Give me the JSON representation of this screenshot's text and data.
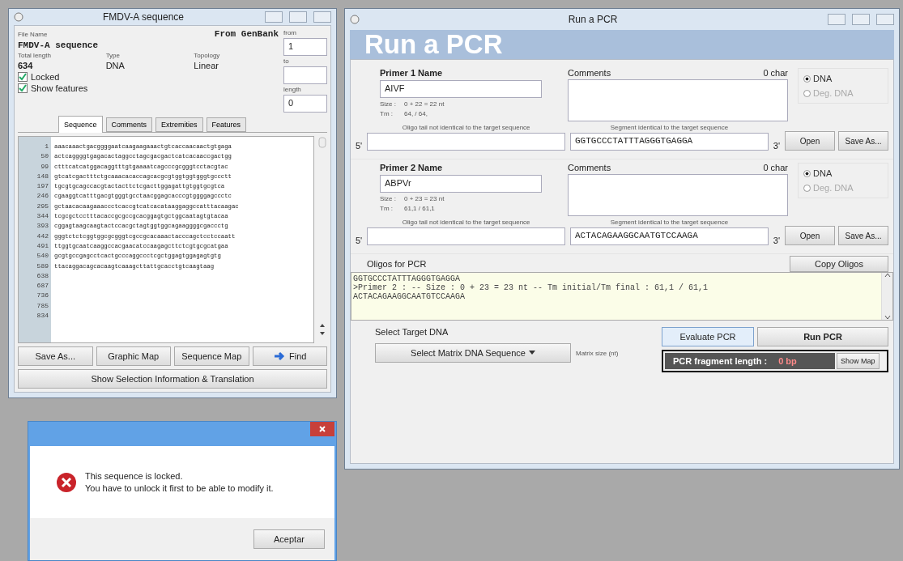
{
  "sequence_window": {
    "title": "FMDV-A sequence",
    "source": "From GenBank",
    "file_name_label": "File Name",
    "file_name": "FMDV-A sequence",
    "total_length_label": "Total length",
    "total_length": "634",
    "type_label": "Type",
    "type": "DNA",
    "topology_label": "Topology",
    "topology": "Linear",
    "from_label": "from",
    "from": "1",
    "to_label": "to",
    "length_label": "length",
    "length": "0",
    "options": [
      {
        "label": "Locked",
        "checked": true
      },
      {
        "label": "Show features",
        "checked": true
      }
    ],
    "tabs": [
      {
        "label": "Sequence",
        "selected": true
      },
      {
        "label": "Comments",
        "selected": false
      },
      {
        "label": "Extremities",
        "selected": false
      },
      {
        "label": "Features",
        "selected": false
      }
    ],
    "sequence_lines": [
      {
        "number": "1",
        "bases": "aaacaaactgacggggaatcaagaagaaactgtcaccaacaactgtgaga"
      },
      {
        "number": "50",
        "bases": "actcaggggtgagacactaggcctagcgacgactcatcacaaccgactgg"
      },
      {
        "number": "99",
        "bases": "ctttcatcatggacaggtttgtgaaaatcagcccgcgggtcctacgtac"
      },
      {
        "number": "148",
        "bases": "gtcatcgactttctgcaaacacaccagcacgcgtggtggtgggtgccctt"
      },
      {
        "number": "197",
        "bases": "tgcgtgcagccacgtactacttctcgacttggagattgtggtgcgtca"
      },
      {
        "number": "246",
        "bases": "cgaaggtcatttgacgtgggtgcctaacggagcacccgtggggagccctc"
      },
      {
        "number": "295",
        "bases": "gctaacacaagaaaccctcaccgtcatcacataaggaggccatttacaagac"
      },
      {
        "number": "344",
        "bases": "tcgcgctcctttacaccgcgccgcacggagtgctggcaatagtgtacaa"
      },
      {
        "number": "393",
        "bases": "cggagtaagcaagtactccacgctagtggtggcagaaggggcgaccctg"
      },
      {
        "number": "442",
        "bases": "gggtctctcggtggcgcgggtcgccgcacaaactacccagctcctccaatt"
      },
      {
        "number": "491",
        "bases": "ttggtgcaatcaaggccacgaacatccaagagcttctcgtgcgcatgaa"
      },
      {
        "number": "540",
        "bases": "gcgtgccgagcctcactgcccaggccctcgctggagtggagagtgtg"
      },
      {
        "number": "589",
        "bases": "ttacaggacagcacaagtcaaagcttattgcacctgtcaagtaag"
      }
    ],
    "empty_line_numbers": [
      "638",
      "687",
      "736",
      "785",
      "834"
    ],
    "buttons": [
      "Save As...",
      "Graphic Map",
      "Sequence Map"
    ],
    "find_button": "Find",
    "wide_button": "Show Selection Information & Translation"
  },
  "alert_dialog": {
    "messages": [
      "This sequence is locked.",
      "You have to unlock it first to be able to modify it."
    ],
    "button": "Aceptar"
  },
  "pcr_window": {
    "title": "Run a PCR",
    "banner": "Run a PCR",
    "primers": [
      {
        "name_label": "Primer 1 Name",
        "name": "AIVF",
        "comments_label": "Comments",
        "char_count": "0 char",
        "size_label": "Size :",
        "size": "0 + 22 = 22 nt",
        "tm_label": "Tm :",
        "tm": "64, / 64,",
        "tail_label": "Oligo tail not identical to the target sequence",
        "segment_label": "Segment identical to the target sequence",
        "five_prime": "5'",
        "segment": "GGTGCCCTATTTAGGGTGAGGA",
        "three_prime": "3'",
        "types": [
          {
            "label": "DNA",
            "selected": true
          },
          {
            "label": "Deg. DNA",
            "selected": false
          }
        ],
        "buttons": [
          "Open",
          "Save As..."
        ]
      },
      {
        "name_label": "Primer 2 Name",
        "name": "ABPVr",
        "comments_label": "Comments",
        "char_count": "0 char",
        "size_label": "Size :",
        "size": "0 + 23 = 23 nt",
        "tm_label": "Tm :",
        "tm": "61,1 / 61,1",
        "tail_label": "Oligo tail not identical to the target sequence",
        "segment_label": "Segment identical to the target sequence",
        "five_prime": "5'",
        "segment": "ACTACAGAAGGCAATGTCCAAGA",
        "three_prime": "3'",
        "types": [
          {
            "label": "DNA",
            "selected": true
          },
          {
            "label": "Deg. DNA",
            "selected": false
          }
        ],
        "buttons": [
          "Open",
          "Save As..."
        ]
      }
    ],
    "oligos_label": "Oligos for PCR",
    "copy_button": "Copy Oligos",
    "oligos_lines": [
      "GGTGCCCTATTTAGGGTGAGGA",
      ">Primer 2 :  -- Size : 0 + 23 = 23 nt -- Tm initial/Tm final : 61,1 / 61,1",
      "ACTACAGAAGGCAATGTCCAAGA"
    ],
    "target_label": "Select Target DNA",
    "select_button": "Select Matrix DNA Sequence",
    "matrix_label": "Matrix size (nt)",
    "evaluate_button": "Evaluate PCR",
    "run_button": "Run PCR",
    "fragment_label": "PCR fragment length :",
    "fragment_value": "0 bp",
    "show_map_button": "Show Map"
  }
}
